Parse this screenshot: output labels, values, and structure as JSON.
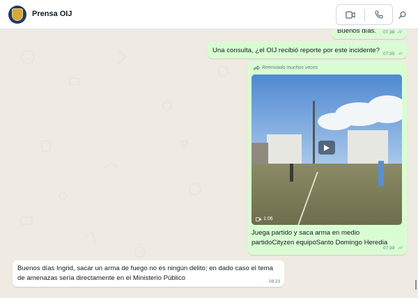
{
  "header": {
    "contact_name": "Prensa OIJ",
    "icons": {
      "video": "video-call-icon",
      "phone": "voice-call-icon",
      "search": "search-icon"
    }
  },
  "messages": [
    {
      "id": "m1",
      "direction": "outgoing",
      "text": "Buenos días.",
      "time": "07:38",
      "status": "read"
    },
    {
      "id": "m2",
      "direction": "outgoing",
      "text": "Una consulta, ¿el OIJ recibió reporte por este incidente?",
      "time": "07:39",
      "status": "read"
    },
    {
      "id": "m3",
      "direction": "outgoing",
      "forwarded_label": "Reenviado muchos veces",
      "media": {
        "type": "video",
        "duration": "1:06"
      },
      "caption": "Juega partido y saca arma en medio partidoCityzen equipoSanto Domingo Heredia",
      "time": "07:39",
      "status": "read"
    },
    {
      "id": "m4",
      "direction": "incoming",
      "text": "Buenos días Ingrid, sacar un arma de fuego no es ningún delito; en dado caso el tema de amenazas sería directamente en el Ministerio Público",
      "time": "08:23"
    }
  ],
  "colors": {
    "outgoing_bubble": "#d9fdd3",
    "incoming_bubble": "#ffffff",
    "chat_background": "#efeae2"
  }
}
